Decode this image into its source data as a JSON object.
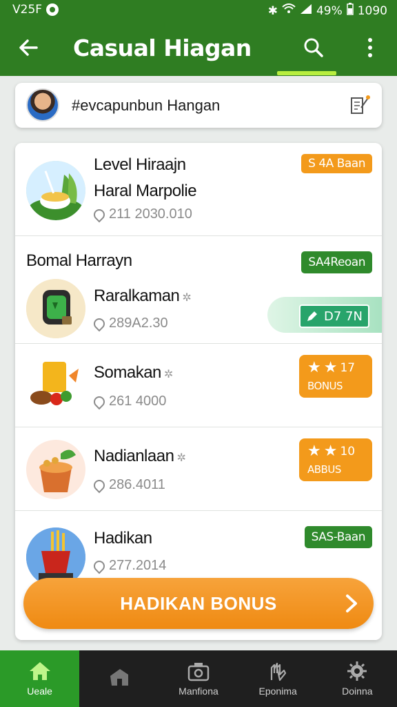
{
  "status_bar": {
    "left_text": "V25F",
    "battery": "49%",
    "time": "1090"
  },
  "app_bar": {
    "title": "Casual Hiagan"
  },
  "profile": {
    "name": "#evcapunbun Hangan"
  },
  "items": [
    {
      "title": "Level Hiraajn",
      "subtitle": "Haral Marpolie",
      "meta": "211 2030.010",
      "badge": "S 4A Baan"
    },
    {
      "title": "Raralkaman",
      "meta": "289A2.30",
      "toggle_label": "D7 7N"
    },
    {
      "title": "Somakan",
      "meta": "261 4000",
      "reward_stars": "17",
      "reward_label": "BONUS"
    },
    {
      "title": "Nadianlaan",
      "meta": "286.4011",
      "reward_stars": "10",
      "reward_label": "ABBUS"
    },
    {
      "title": "Hadikan",
      "meta": "277.2014",
      "badge": "SAS-Baan"
    }
  ],
  "section": {
    "title": "Bomal Harrayn",
    "badge": "SA4Reoan"
  },
  "cta": {
    "label": "HADIKAN BONUS"
  },
  "bottom_nav": [
    {
      "label": "Ueale",
      "icon": "home-icon"
    },
    {
      "label": "",
      "icon": "house-icon"
    },
    {
      "label": "Manfiona",
      "icon": "camera-icon"
    },
    {
      "label": "Eponima",
      "icon": "hand-icon"
    },
    {
      "label": "Doinna",
      "icon": "gear-icon"
    }
  ],
  "colors": {
    "primary": "#2f7d22",
    "accent": "#f39a1b",
    "indicator": "#b8ee3e"
  }
}
